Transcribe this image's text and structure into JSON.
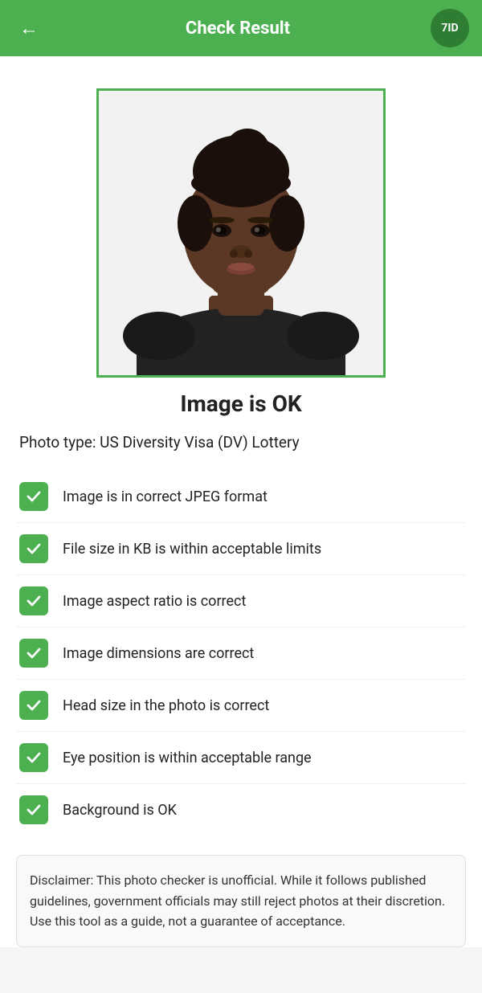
{
  "header": {
    "title": "Check Result",
    "back_label": "←",
    "logo_text": "7ID"
  },
  "status": {
    "title": "Image is OK"
  },
  "photo_type": {
    "label": "Photo type: US Diversity Visa (DV) Lottery"
  },
  "check_items": [
    {
      "id": "jpeg",
      "text": "Image is in correct JPEG format",
      "passed": true
    },
    {
      "id": "filesize",
      "text": "File size in KB is within acceptable limits",
      "passed": true
    },
    {
      "id": "aspect",
      "text": "Image aspect ratio is correct",
      "passed": true
    },
    {
      "id": "dimensions",
      "text": "Image dimensions are correct",
      "passed": true
    },
    {
      "id": "headsize",
      "text": "Head size in the photo is correct",
      "passed": true
    },
    {
      "id": "eyepos",
      "text": "Eye position is within acceptable range",
      "passed": true
    },
    {
      "id": "background",
      "text": "Background is OK",
      "passed": true
    }
  ],
  "disclaimer": {
    "text": "Disclaimer: This photo checker is unofficial. While it follows published guidelines, government officials may still reject photos at their discretion. Use this tool as a guide, not a guarantee of acceptance."
  }
}
